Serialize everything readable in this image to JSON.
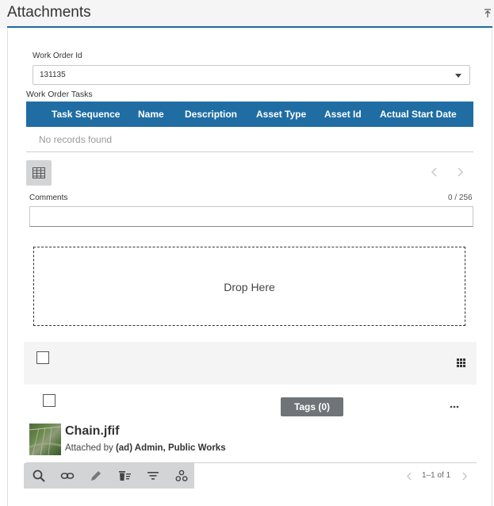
{
  "panel": {
    "title": "Attachments"
  },
  "work_order": {
    "label": "Work Order Id",
    "value": "131135"
  },
  "tasks": {
    "label": "Work Order Tasks",
    "columns": [
      "Task Sequence",
      "Name",
      "Description",
      "Asset Type",
      "Asset Id",
      "Actual Start Date"
    ],
    "empty_text": "No records found"
  },
  "comments": {
    "label": "Comments",
    "counter": "0 / 256",
    "value": ""
  },
  "dropzone": {
    "text": "Drop Here"
  },
  "attachment": {
    "tags_label": "Tags (0)",
    "file_name": "Chain.jfif",
    "attached_prefix": "Attached by",
    "attached_by": "(ad) Admin, Public Works"
  },
  "pager": {
    "range": "1–1 of 1"
  },
  "colors": {
    "primary": "#1f6da3",
    "toolbar_bg": "#d2d4d6",
    "tags_bg": "#6e7478"
  },
  "icons": {
    "header": "collapse-up-icon",
    "grid_tool": "table-icon",
    "view": "grid-view-icon",
    "more": "more-horizontal-icon",
    "actions": [
      "search-icon",
      "link-icon",
      "pencil-icon",
      "delete-list-icon",
      "filter-icon",
      "settings-icon"
    ]
  }
}
